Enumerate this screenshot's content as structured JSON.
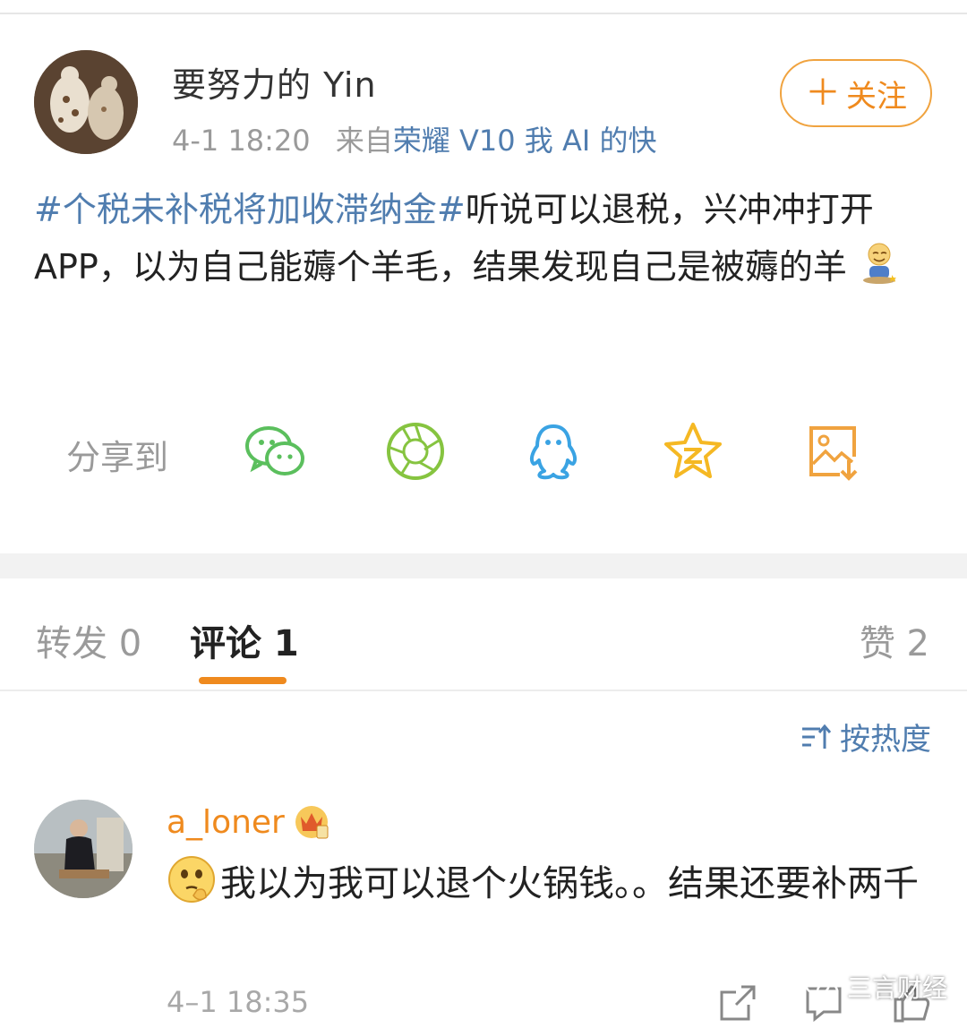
{
  "post": {
    "username": "要努力的 Yin",
    "time": "4-1 18:20",
    "source_prefix": "来自",
    "source": "荣耀 V10 我 AI 的快",
    "follow_label": "关注",
    "hashtag": "#个税未补税将加收滞纳金#",
    "body": "听说可以退税，兴冲冲打开 APP，以为自己能薅个羊毛，结果发现自己是被薅的羊"
  },
  "share": {
    "label": "分享到",
    "targets": [
      "wechat-icon",
      "moments-icon",
      "qq-icon",
      "qzone-icon",
      "save-image-icon"
    ]
  },
  "tabs": {
    "repost_label": "转发 0",
    "comment_label": "评论 1",
    "like_label": "赞 2"
  },
  "sort": {
    "label": "按热度"
  },
  "comment": {
    "username": "a_loner",
    "text": "我以为我可以退个火锅钱。。结果还要补两千",
    "time": "4–1 18:35"
  },
  "watermark": {
    "text": "三言财经"
  },
  "colors": {
    "accent": "#ef8a1e",
    "link": "#507daf",
    "muted": "#9a9a9a"
  }
}
